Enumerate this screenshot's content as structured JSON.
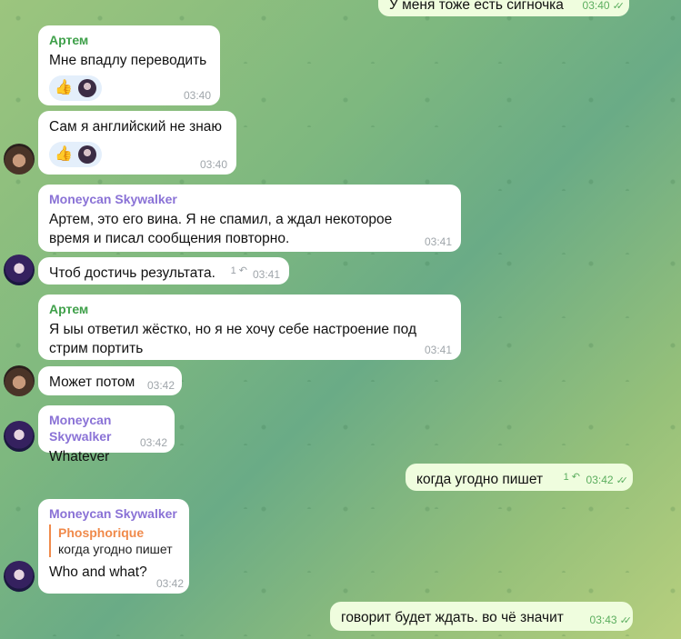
{
  "chat": {
    "messages": [
      {
        "text": "У меня тоже есть сигночка",
        "time": "03:40"
      },
      {
        "sender": "Артем",
        "text": "Мне впадлу переводить",
        "time": "03:40",
        "reaction": "👍"
      },
      {
        "text": "Сам я английский не знаю",
        "time": "03:40",
        "reaction": "👍"
      },
      {
        "sender": "Moneycan Skywalker",
        "text": "Артем, это его вина. Я не спамил, а ждал некоторое время и писал сообщения повторно.",
        "time": "03:41"
      },
      {
        "text": "Чтоб достичь результата.",
        "time": "03:41",
        "replies": "1"
      },
      {
        "sender": "Артем",
        "text": "Я ыы ответил жёстко, но я не хочу себе настроение под стрим портить",
        "time": "03:41"
      },
      {
        "text": "Может потом",
        "time": "03:42"
      },
      {
        "sender": "Moneycan Skywalker",
        "text": "Whatever",
        "time": "03:42"
      },
      {
        "text": "когда угодно пишет",
        "time": "03:42",
        "replies": "1"
      },
      {
        "sender": "Moneycan Skywalker",
        "quote_name": "Phosphorique",
        "quote_text": "когда угодно пишет",
        "text": "Who and what?",
        "time": "03:42"
      },
      {
        "text": "говорит будет ждать. во чё значит",
        "time": "03:43"
      }
    ]
  },
  "colors": {
    "outgoing_bubble": "#effdde",
    "incoming_bubble": "#ffffff",
    "sender_artem": "#3fa04a",
    "sender_moneycan": "#8a72d6",
    "quote_accent": "#f08a4b"
  },
  "icons": {
    "read_receipt": "double-check-icon",
    "reply": "reply-arrow-icon"
  }
}
